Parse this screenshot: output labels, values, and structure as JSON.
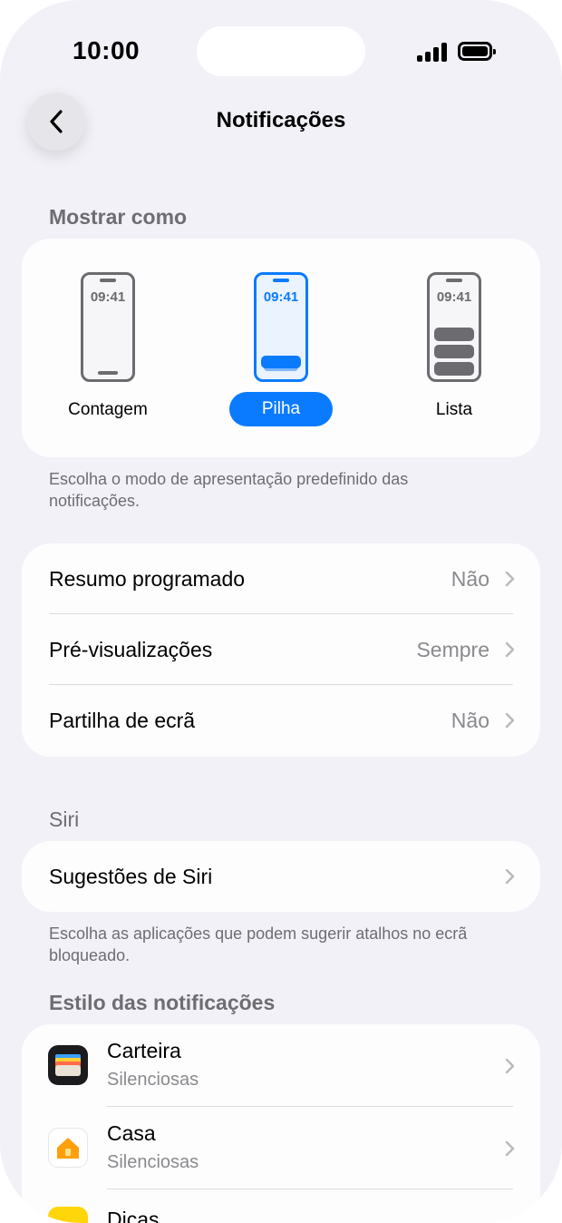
{
  "status_bar": {
    "time": "10:00"
  },
  "nav": {
    "title": "Notificações"
  },
  "show_as": {
    "header": "Mostrar como",
    "modes": [
      {
        "label": "Contagem",
        "clock": "09:41",
        "selected": false
      },
      {
        "label": "Pilha",
        "clock": "09:41",
        "selected": true
      },
      {
        "label": "Lista",
        "clock": "09:41",
        "selected": false
      }
    ],
    "footnote": "Escolha o modo de apresentação predefinido das notificações."
  },
  "settings": {
    "rows": [
      {
        "label": "Resumo programado",
        "value": "Não"
      },
      {
        "label": "Pré-visualizações",
        "value": "Sempre"
      },
      {
        "label": "Partilha de ecrã",
        "value": "Não"
      }
    ]
  },
  "siri": {
    "header": "Siri",
    "row_label": "Sugestões de Siri",
    "footnote": "Escolha as aplicações que podem sugerir atalhos no ecrã bloqueado."
  },
  "style": {
    "header": "Estilo das notificações",
    "apps": [
      {
        "name": "Carteira",
        "status": "Silenciosas",
        "icon": "wallet-icon"
      },
      {
        "name": "Casa",
        "status": "Silenciosas",
        "icon": "home-icon"
      },
      {
        "name": "Dicas",
        "status": "",
        "icon": "tips-icon"
      }
    ]
  },
  "colors": {
    "accent": "#0A7BFF",
    "background": "#F2F1F7",
    "card": "#FDFDFE",
    "secondary_text": "#8A8A8E"
  }
}
